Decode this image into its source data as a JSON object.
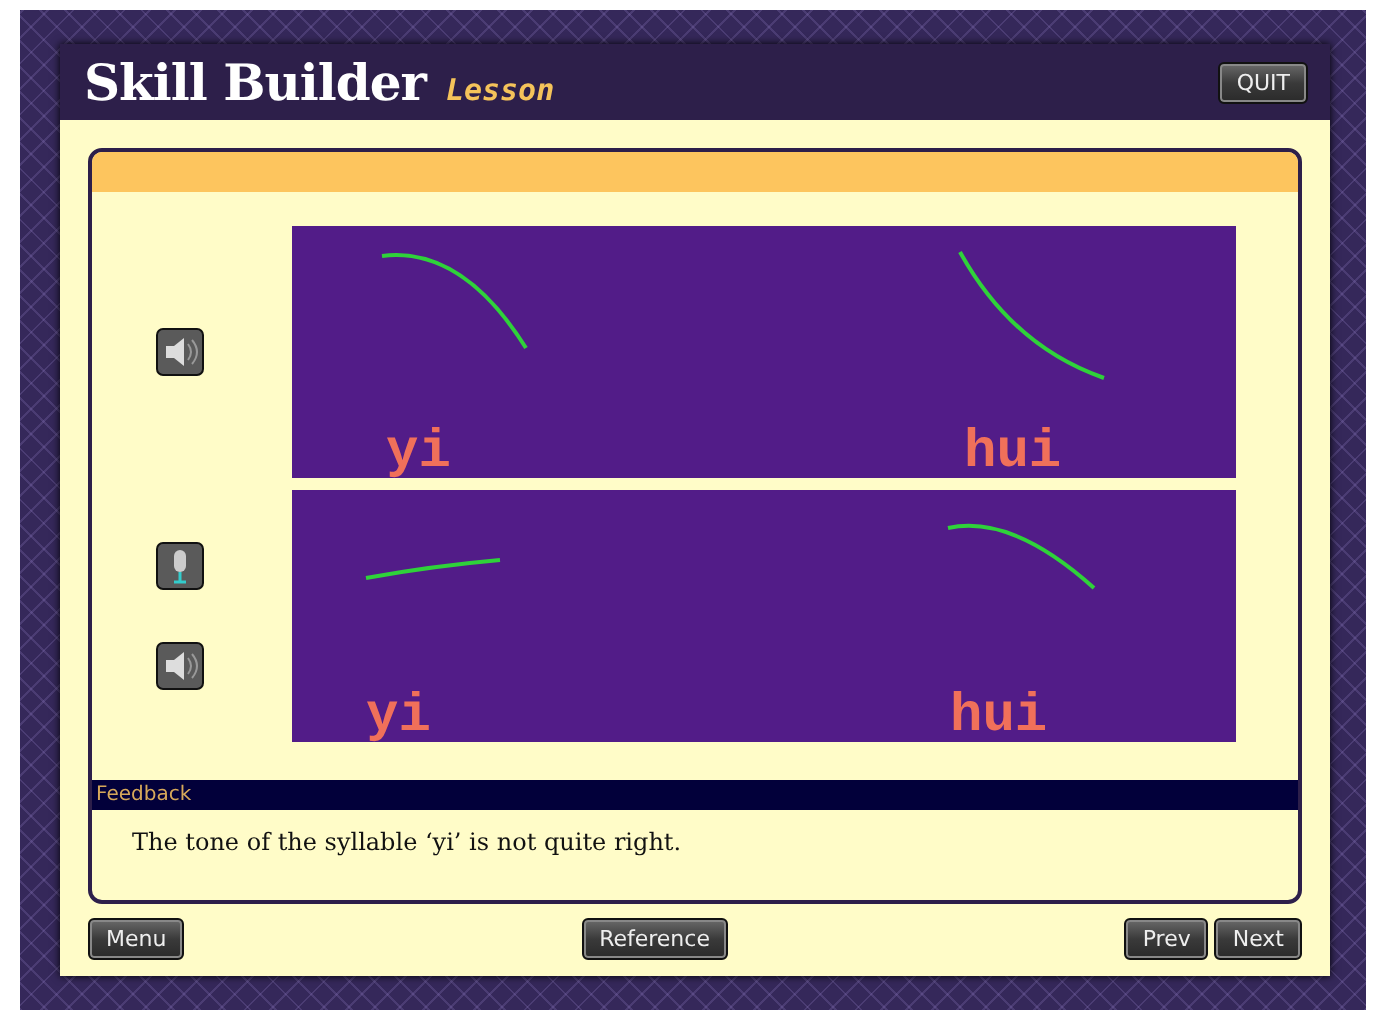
{
  "app": {
    "title": "Skill Builder",
    "subtitle": "Lesson",
    "quit": "QUIT"
  },
  "side_controls": [
    {
      "kind": "speaker"
    },
    {
      "kind": "microphone"
    },
    {
      "kind": "speaker"
    }
  ],
  "panels": [
    {
      "syllables": [
        "yi",
        "hui"
      ]
    },
    {
      "syllables": [
        "yi",
        "hui"
      ]
    }
  ],
  "feedback": {
    "label": "Feedback",
    "text": "The tone of the syllable ‘yi’ is not quite right."
  },
  "buttons": {
    "menu": "Menu",
    "reference": "Reference",
    "prev": "Prev",
    "next": "Next"
  }
}
